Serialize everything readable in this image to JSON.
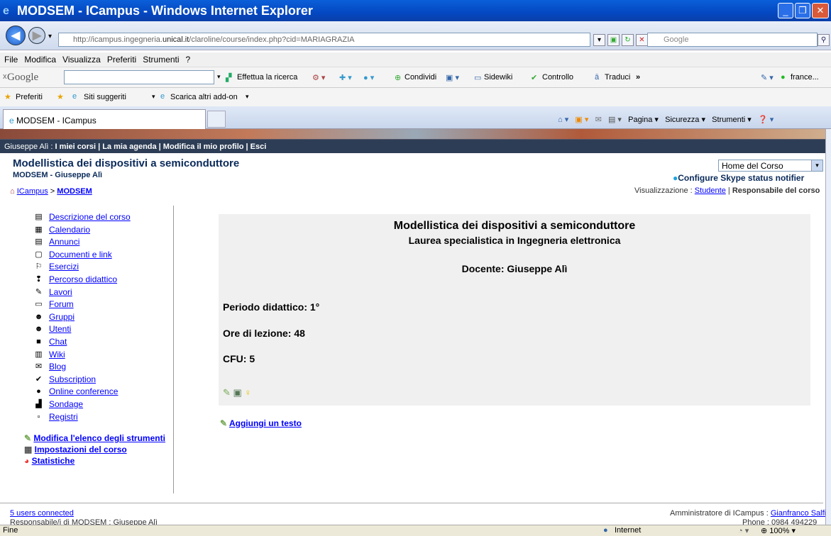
{
  "window": {
    "title": "MODSEM - ICampus - Windows Internet Explorer",
    "url_pre": "http://icampus.ingegneria.",
    "url_host": "unical.it",
    "url_post": "/claroline/course/index.php?cid=MARIAGRAZIA",
    "search_placeholder": "Google"
  },
  "menu": [
    "File",
    "Modifica",
    "Visualizza",
    "Preferiti",
    "Strumenti",
    "?"
  ],
  "google_toolbar": {
    "label": "Google",
    "effettua": "Effettua la ricerca",
    "condividi": "Condividi",
    "sidewiki": "Sidewiki",
    "controllo": "Controllo",
    "traduci": "Traduci",
    "user": "france..."
  },
  "favorites": {
    "preferiti": "Preferiti",
    "siti": "Siti suggeriti",
    "scarica": "Scarica altri add-on"
  },
  "tab": {
    "title": "MODSEM - ICampus",
    "pagina": "Pagina",
    "sicurezza": "Sicurezza",
    "strumenti": "Strumenti"
  },
  "userbar": {
    "user": "Giuseppe Alì",
    "links": "I miei corsi | La mia agenda | Modifica il mio profilo | Esci"
  },
  "course": {
    "title": "Modellistica dei dispositivi a semiconduttore",
    "subtitle": "MODSEM - Giuseppe Alì",
    "home_select": "Home del Corso",
    "skype": "Configure Skype status notifier",
    "view_label": "Visualizzazione : ",
    "view_student": "Studente",
    "view_sep": " | ",
    "view_resp": "Responsabile del corso",
    "bc_root": "ICampus",
    "bc_sep": " > ",
    "bc_course": "MODSEM"
  },
  "sidebar": {
    "items": [
      {
        "label": "Descrizione del corso",
        "icon": "description-icon",
        "glyph": "▤"
      },
      {
        "label": "Calendario",
        "icon": "calendar-icon",
        "glyph": "▦"
      },
      {
        "label": "Annunci",
        "icon": "announcements-icon",
        "glyph": "▤"
      },
      {
        "label": "Documenti e link",
        "icon": "documents-icon",
        "glyph": "▢"
      },
      {
        "label": "Esercizi",
        "icon": "exercises-icon",
        "glyph": "⚐"
      },
      {
        "label": "Percorso didattico",
        "icon": "learning-path-icon",
        "glyph": "❢"
      },
      {
        "label": "Lavori",
        "icon": "works-icon",
        "glyph": "✎"
      },
      {
        "label": "Forum",
        "icon": "forum-icon",
        "glyph": "▭"
      },
      {
        "label": "Gruppi",
        "icon": "groups-icon",
        "glyph": "☻"
      },
      {
        "label": "Utenti",
        "icon": "users-icon",
        "glyph": "☻"
      },
      {
        "label": "Chat",
        "icon": "chat-icon",
        "glyph": "■"
      },
      {
        "label": "Wiki",
        "icon": "wiki-icon",
        "glyph": "▥"
      },
      {
        "label": "Blog",
        "icon": "blog-icon",
        "glyph": "✉"
      },
      {
        "label": "Subscription",
        "icon": "subscription-icon",
        "glyph": "✔"
      },
      {
        "label": "Online conference",
        "icon": "conference-icon",
        "glyph": "●"
      },
      {
        "label": "Sondage",
        "icon": "poll-icon",
        "glyph": "▟"
      },
      {
        "label": "Registri",
        "icon": "registers-icon",
        "glyph": "▫"
      }
    ],
    "actions": {
      "modifica": "Modifica l'elenco degli strumenti",
      "impostazioni": "Impostazioni del corso",
      "statistiche": "Statistiche"
    }
  },
  "main": {
    "title": "Modellistica dei dispositivi a semiconduttore",
    "subtitle": "Laurea specialistica in Ingegneria elettronica",
    "docente": "Docente: Giuseppe Alì",
    "periodo": "Periodo didattico:  1°",
    "ore": "Ore di lezione: 48",
    "cfu": "CFU: 5",
    "add_text": "Aggiungi un testo"
  },
  "footer": {
    "users": "5 users connected",
    "responsabile": "Responsabile/i di MODSEM : Giuseppe Alì",
    "admin_label": "Amministratore di ICampus : ",
    "admin_name": "Gianfranco Salfi",
    "phone": "Phone : 0984 494229"
  },
  "status": {
    "text": "Fine",
    "zone": "Internet",
    "zoom": "100%"
  },
  "colors": {
    "titlebar": "#0448c2",
    "userbar": "#2d3d55",
    "link": "#0000ff",
    "course_title": "#0a2a5a"
  }
}
